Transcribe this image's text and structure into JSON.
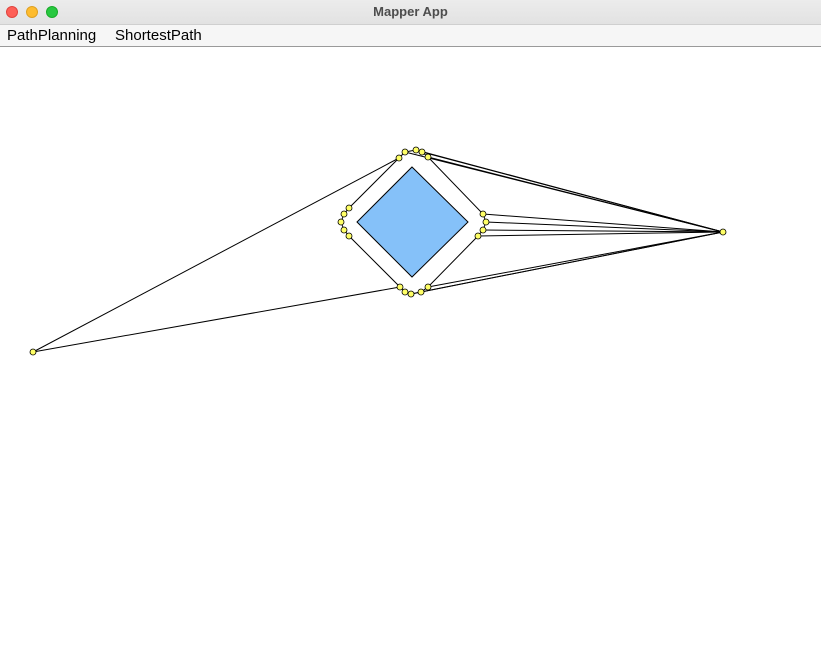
{
  "window": {
    "title": "Mapper App"
  },
  "menubar": {
    "items": [
      {
        "label": "PathPlanning"
      },
      {
        "label": "ShortestPath"
      }
    ]
  },
  "colors": {
    "obstacle_fill": "#85c1f9",
    "node_fill": "#ffff66",
    "edge": "#000000"
  },
  "icons": [
    "close-window-icon",
    "minimize-window-icon",
    "zoom-window-icon"
  ]
}
